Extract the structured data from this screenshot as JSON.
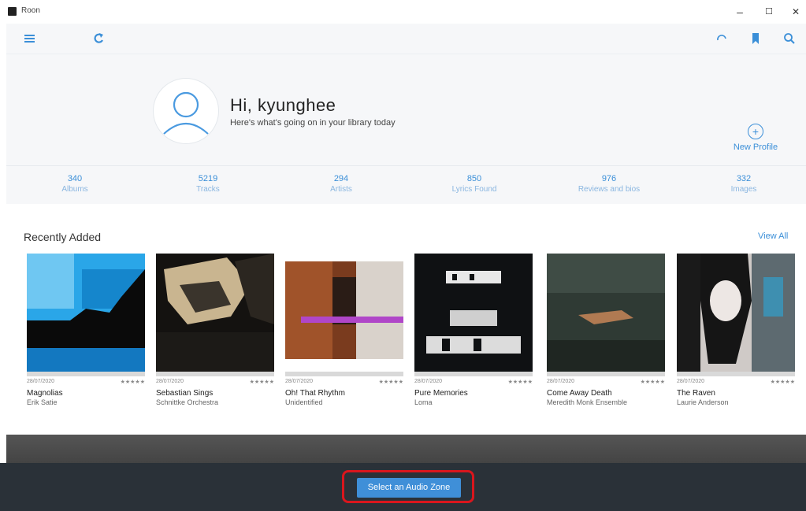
{
  "window": {
    "title": "Roon",
    "minimize": "–",
    "maximize": "☐",
    "close": "✕"
  },
  "toolbar": {
    "menu_icon": "menu-icon",
    "refresh_icon": "refresh-icon",
    "spinner_icon": "spinner-icon",
    "bookmark_icon": "bookmark-icon",
    "search_icon": "search-icon"
  },
  "profile": {
    "greeting": "Hi, kyunghee",
    "subtitle": "Here's what's going on in your library today",
    "new_profile": "New Profile",
    "new_profile_symbol": "+"
  },
  "stats": [
    {
      "value": "340",
      "label": "Albums"
    },
    {
      "value": "5219",
      "label": "Tracks"
    },
    {
      "value": "294",
      "label": "Artists"
    },
    {
      "value": "850",
      "label": "Lyrics Found"
    },
    {
      "value": "976",
      "label": "Reviews and bios"
    },
    {
      "value": "332",
      "label": "Images"
    }
  ],
  "recently_added": {
    "title": "Recently Added",
    "view_all": "View All",
    "albums": [
      {
        "title": "Magnolias",
        "artist": "Erik Satie",
        "date": "28/07/2020",
        "rating": "★★★★★"
      },
      {
        "title": "Sebastian Sings",
        "artist": "Schnittke Orchestra",
        "date": "28/07/2020",
        "rating": "★★★★★"
      },
      {
        "title": "Oh! That Rhythm",
        "artist": "Unidentified",
        "date": "28/07/2020",
        "rating": "★★★★★"
      },
      {
        "title": "Pure Memories",
        "artist": "Loma",
        "date": "28/07/2020",
        "rating": "★★★★★"
      },
      {
        "title": "Come Away Death",
        "artist": "Meredith Monk Ensemble",
        "date": "28/07/2020",
        "rating": "★★★★★"
      },
      {
        "title": "The Raven",
        "artist": "Laurie Anderson",
        "date": "28/07/2020",
        "rating": "★★★★★"
      }
    ]
  },
  "footer": {
    "zone_button": "Select an Audio Zone"
  },
  "colors": {
    "accent": "#3b8fd8",
    "highlight": "#d9161d",
    "bar": "#2a3138"
  }
}
